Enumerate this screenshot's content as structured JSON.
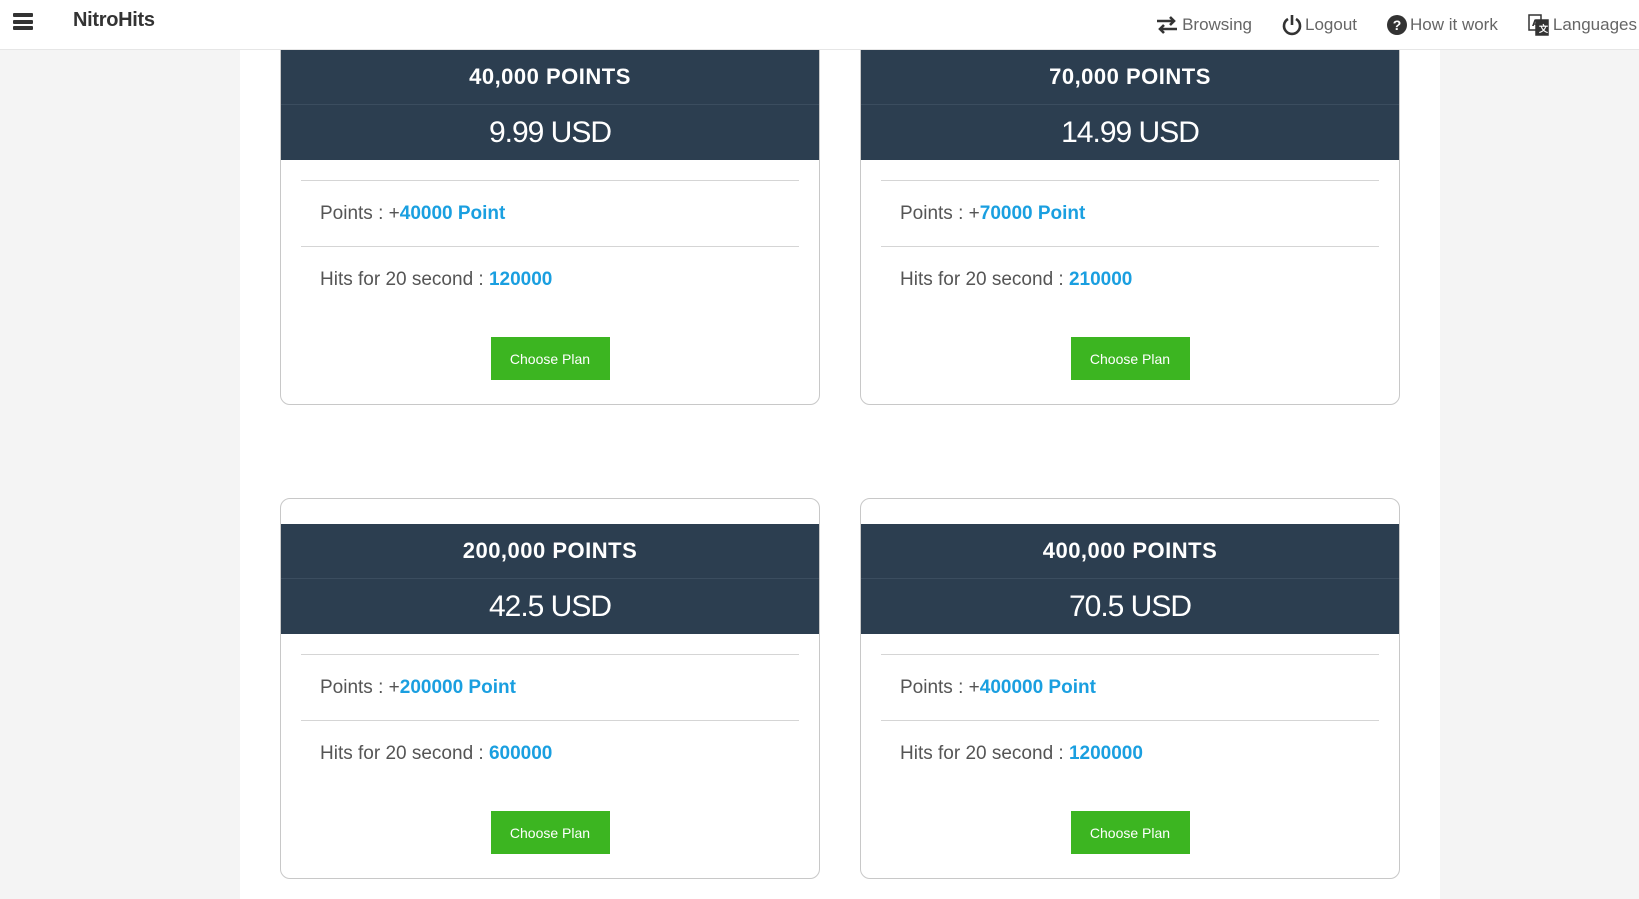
{
  "navbar": {
    "brand": "NitroHits",
    "links": [
      {
        "label": "Browsing",
        "icon": "arrows-exchange-icon"
      },
      {
        "label": "Logout",
        "icon": "power-icon"
      },
      {
        "label": "How it work",
        "icon": "question-circle-icon"
      },
      {
        "label": "Languages",
        "icon": "translate-icon"
      }
    ]
  },
  "plans": [
    {
      "title": "40,000 POINTS",
      "price": "9.99 USD",
      "points_label": "Points : +",
      "points_value": "40000 Point",
      "hits_label": "Hits for 20 second : ",
      "hits_value": "120000",
      "button": "Choose Plan"
    },
    {
      "title": "70,000 POINTS",
      "price": "14.99 USD",
      "points_label": "Points : +",
      "points_value": "70000 Point",
      "hits_label": "Hits for 20 second : ",
      "hits_value": "210000",
      "button": "Choose Plan"
    },
    {
      "title": "200,000 POINTS",
      "price": "42.5 USD",
      "points_label": "Points : +",
      "points_value": "200000 Point",
      "hits_label": "Hits for 20 second : ",
      "hits_value": "600000",
      "button": "Choose Plan"
    },
    {
      "title": "400,000 POINTS",
      "price": "70.5 USD",
      "points_label": "Points : +",
      "points_value": "400000 Point",
      "hits_label": "Hits for 20 second : ",
      "hits_value": "1200000",
      "button": "Choose Plan"
    }
  ],
  "colors": {
    "header_bg": "#2c3e50",
    "accent_blue": "#1a9fe0",
    "button_green": "#3cb521"
  }
}
